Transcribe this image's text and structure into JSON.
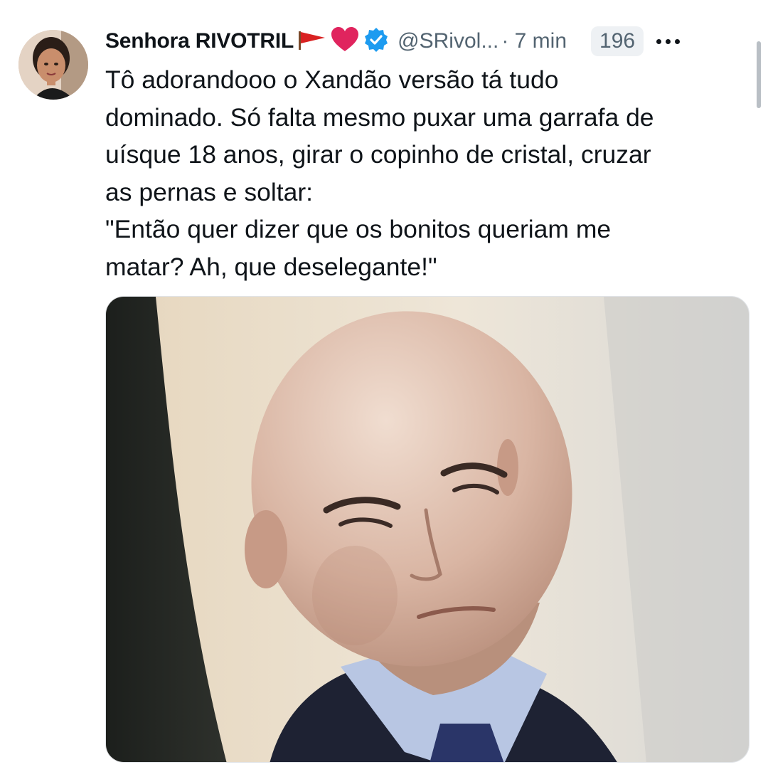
{
  "tweet": {
    "author": {
      "display_name": "Senhora RIVOTRIL",
      "handle": "@SRivol...",
      "badges": [
        "flag-icon",
        "heart-icon",
        "verified-icon"
      ]
    },
    "time": "· 7 min",
    "count": "196",
    "text_lines": [
      "Tô adorandooo o Xandão versão tá tudo",
      "dominado. Só falta mesmo puxar uma garrafa de",
      "uísque 18 anos, girar o copinho de cristal, cruzar",
      "as pernas e soltar:",
      "\"Então quer dizer que os bonitos queriam me",
      "matar? Ah, que deselegante!\""
    ],
    "colors": {
      "text": "#0f1419",
      "secondary": "#536471",
      "verified": "#1d9bf0",
      "heart": "#e0245e",
      "flag": "#d92222"
    }
  }
}
